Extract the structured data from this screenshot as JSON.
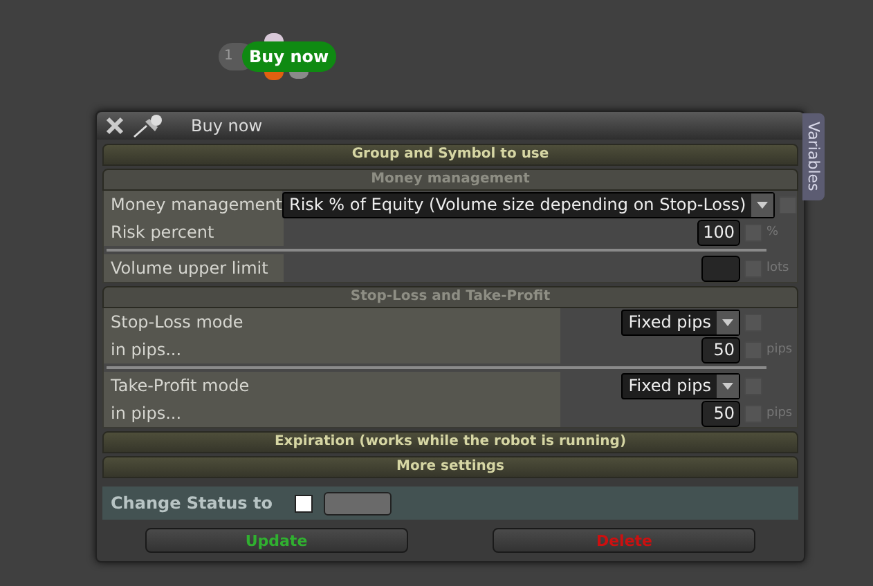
{
  "node": {
    "index": "1",
    "label": "Buy now"
  },
  "window": {
    "title": "Buy now"
  },
  "side_tab": "Variables",
  "sections": [
    {
      "title": "Group and Symbol to use",
      "expanded": false
    },
    {
      "title": "Money management",
      "expanded": true,
      "kind": "compact",
      "groups": [
        [
          {
            "kind": "select",
            "label": "Money management",
            "value": "Risk % of Equity (Volume size depending on Stop-Loss)",
            "checked": false
          },
          {
            "kind": "number",
            "label": "Risk percent",
            "value": "100",
            "checked": false,
            "unit": "%"
          }
        ],
        [
          {
            "kind": "number",
            "label": "Volume upper limit",
            "checked": false,
            "unit": "lots"
          }
        ]
      ]
    },
    {
      "title": "Stop-Loss and Take-Profit",
      "expanded": true,
      "kind": "wide",
      "groups": [
        [
          {
            "kind": "select",
            "label": "Stop-Loss mode",
            "value": "Fixed pips",
            "checked": false
          },
          {
            "kind": "number",
            "label": "in pips...",
            "value": "50",
            "checked": false,
            "unit": "pips"
          }
        ],
        [
          {
            "kind": "select",
            "label": "Take-Profit mode",
            "value": "Fixed pips",
            "checked": false
          },
          {
            "kind": "number",
            "label": "in pips...",
            "value": "50",
            "checked": false,
            "unit": "pips"
          }
        ]
      ]
    },
    {
      "title": "Expiration (works while the robot is running)",
      "expanded": false
    },
    {
      "title": "More settings",
      "expanded": false
    }
  ],
  "status": {
    "label": "Change Status to",
    "checked": false
  },
  "buttons": [
    {
      "label": "Update",
      "kind": "update"
    },
    {
      "label": "Delete",
      "kind": "delete"
    }
  ]
}
